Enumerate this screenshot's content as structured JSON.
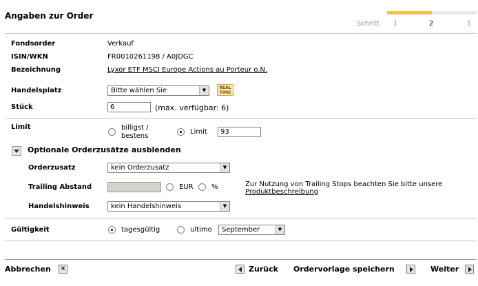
{
  "header": {
    "title": "Angaben zur Order",
    "steps_label": "Schritt",
    "steps": [
      "1",
      "2",
      "3"
    ],
    "current_step": 2,
    "progress": 0.5
  },
  "order": {
    "fondsorder_label": "Fondsorder",
    "fondsorder_value": "Verkauf",
    "isin_label": "ISIN/WKN",
    "isin_value": "FR0010261198 / A0JDGC",
    "bezeichnung_label": "Bezeichnung",
    "bezeichnung_value": "Lyxor ETF MSCI Europe Actions au Porteur o.N.",
    "handelsplatz_label": "Handelsplatz",
    "handelsplatz_value": "Bitte wählen Sie",
    "realtime_badge_line1": "REAL",
    "realtime_badge_line2": "TIME",
    "stueck_label": "Stück",
    "stueck_value": "6",
    "stueck_hint": "(max. verfügbar: 6)"
  },
  "limit": {
    "label": "Limit",
    "option_best_line1": "billigst /",
    "option_best_line2": "bestens",
    "option_limit": "Limit",
    "limit_value": "93",
    "selected": "limit"
  },
  "optional": {
    "toggle_label": "Optionale Orderzusätze ausblenden",
    "orderzusatz_label": "Orderzusatz",
    "orderzusatz_value": "kein Orderzusatz",
    "trailing_label": "Trailing Abstand",
    "trailing_value": "",
    "unit_eur": "EUR",
    "unit_pct": "%",
    "trailing_info": "Zur Nutzung von Trailing Stops beachten Sie bitte unsere",
    "trailing_link": "Produktbeschreibung",
    "handelshinweis_label": "Handelshinweis",
    "handelshinweis_value": "kein Handelshinweis"
  },
  "validity": {
    "label": "Gültigkeit",
    "option_day": "tagesgültig",
    "option_ultimo": "ultimo",
    "month_value": "September",
    "selected": "tagesgueltig"
  },
  "footer": {
    "cancel": "Abbrechen",
    "back": "Zurück",
    "save_template": "Ordervorlage speichern",
    "next": "Weiter"
  },
  "colors": {
    "progress_fill": "#f5c24d",
    "progress_track": "#e8e8e8",
    "divider": "#c7c7c7"
  }
}
